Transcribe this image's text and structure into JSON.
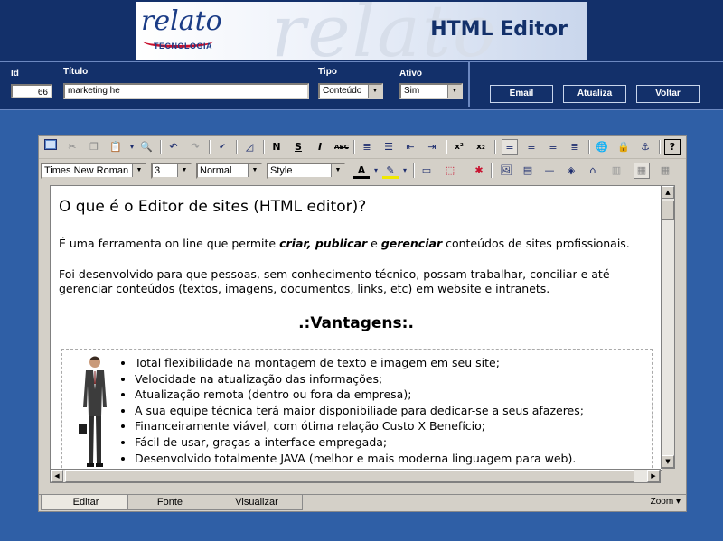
{
  "header": {
    "logo_word": "relato",
    "logo_watermark": "relato",
    "logo_sub": "TECNOLOGIA",
    "title": "HTML Editor"
  },
  "form": {
    "id_label": "Id",
    "id_value": "66",
    "titulo_label": "Título",
    "titulo_value": "marketing he",
    "tipo_label": "Tipo",
    "tipo_value": "Conteúdo",
    "ativo_label": "Ativo",
    "ativo_value": "Sim"
  },
  "buttons": {
    "email": "Email",
    "atualiza": "Atualiza",
    "voltar": "Voltar"
  },
  "toolbar": {
    "font_name": "Times New Roman",
    "font_size": "3",
    "paragraph": "Normal",
    "style": "Style",
    "bold": "N",
    "underline": "S",
    "italic": "I",
    "strike": "ABC",
    "superscript": "x²",
    "subscript": "x₂",
    "icons": [
      "preview-icon",
      "cut-icon",
      "copy-icon",
      "paste-icon",
      "find-icon",
      "undo-icon",
      "redo-icon",
      "spellcheck-icon",
      "eraser-icon",
      "numbered-list-icon",
      "bullet-list-icon",
      "outdent-icon",
      "indent-icon",
      "align-left-icon",
      "align-center-icon",
      "align-right-icon",
      "justify-icon",
      "link-icon",
      "unlink-icon",
      "anchor-icon",
      "help-icon"
    ]
  },
  "document": {
    "heading": "O que é o Editor de sites (HTML editor)?",
    "p1_a": "É uma ferramenta on line que permite ",
    "p1_b": "criar, publicar",
    "p1_c": " e ",
    "p1_d": "gerenciar",
    "p1_e": " conteúdos de sites profissionais.",
    "p2": "Foi desenvolvido para que pessoas, sem conhecimento técnico, possam trabalhar, conciliar e até gerenciar conteúdos (textos, imagens, documentos, links, etc) em website e intranets.",
    "section_title": ".:Vantagens:.",
    "advantages": [
      "Total flexibilidade na montagem de texto e imagem em seu site;",
      "Velocidade na atualização das informações;",
      "Atualização remota (dentro ou fora da empresa);",
      "A sua equipe técnica terá maior disponibiliade para dedicar-se a seus afazeres;",
      "Financeiramente viável, com ótima relação Custo X Benefício;",
      "Fácil de usar, graças a interface empregada;",
      "Desenvolvido totalmente JAVA (melhor e mais moderna linguagem para web)."
    ]
  },
  "tabs": {
    "editar": "Editar",
    "fonte": "Fonte",
    "visualizar": "Visualizar",
    "zoom": "Zoom"
  },
  "colors": {
    "background": "#2f5fa6",
    "navy": "#13306a",
    "logo_red": "#c8102e"
  }
}
